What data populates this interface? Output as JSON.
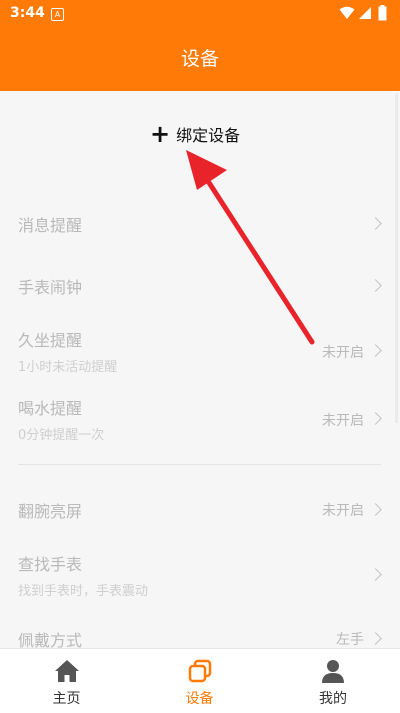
{
  "status_bar": {
    "time": "3:44",
    "badge": "A"
  },
  "header": {
    "title": "设备"
  },
  "bind_button": {
    "plus": "+",
    "label": "绑定设备"
  },
  "settings": [
    {
      "label": "消息提醒",
      "sub": "",
      "value": ""
    },
    {
      "label": "手表闹钟",
      "sub": "",
      "value": ""
    },
    {
      "label": "久坐提醒",
      "sub": "1小时未活动提醒",
      "value": "未开启"
    },
    {
      "label": "喝水提醒",
      "sub": "0分钟提醒一次",
      "value": "未开启"
    },
    {
      "label": "翻腕亮屏",
      "sub": "",
      "value": "未开启"
    },
    {
      "label": "查找手表",
      "sub": "找到手表时，手表震动",
      "value": ""
    },
    {
      "label": "佩戴方式",
      "sub": "",
      "value": "左手"
    }
  ],
  "bottom_nav": [
    {
      "label": "主页",
      "icon": "home-icon",
      "active": false
    },
    {
      "label": "设备",
      "icon": "device-icon",
      "active": true
    },
    {
      "label": "我的",
      "icon": "profile-icon",
      "active": false
    }
  ],
  "colors": {
    "accent": "#ff7a06",
    "arrow": "#e8242a",
    "muted_text": "#b9b9b9"
  }
}
